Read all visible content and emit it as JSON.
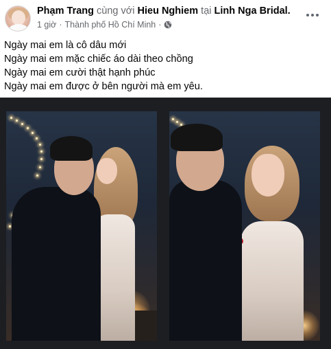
{
  "post": {
    "author": "Phạm Trang",
    "with_word": "cùng với",
    "tagged": "Hieu Nghiem",
    "at_word": "tại",
    "place_tag": "Linh Nga Bridal.",
    "time": "1 giờ",
    "separator": "·",
    "location": "Thành phố Hồ Chí Minh",
    "separator2": "·",
    "privacy_icon": "globe-icon",
    "more_icon": "more-options-icon",
    "caption_lines": [
      "Ngày mai em là cô dâu mới",
      "Ngày mai em mặc chiếc áo dài theo chồng",
      "Ngày mai em cười thật hạnh phúc",
      "Ngày mai em được ở bên người mà em yêu."
    ]
  },
  "colors": {
    "primary_text": "#050505",
    "secondary_text": "#65676b",
    "photo_background": "#1c1e22"
  },
  "photos": [
    {
      "description_icon": "wedding-photo-kiss"
    },
    {
      "description_icon": "wedding-photo-smile"
    }
  ]
}
